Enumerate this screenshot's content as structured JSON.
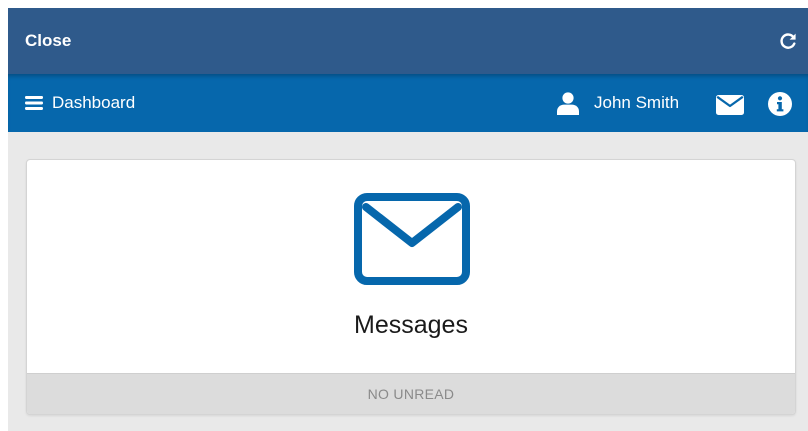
{
  "topbar": {
    "close_label": "Close",
    "refresh_icon": "refresh-icon"
  },
  "navbar": {
    "menu_icon": "hamburger-icon",
    "dashboard_label": "Dashboard",
    "user_icon": "user-icon",
    "user_name": "John Smith",
    "mail_icon": "envelope-icon",
    "info_icon": "info-icon"
  },
  "messages_card": {
    "icon": "envelope-outline-icon",
    "title": "Messages",
    "status": "NO UNREAD"
  },
  "colors": {
    "topbar_bg": "#2f5a8b",
    "navbar_bg": "#0667ac",
    "accent": "#0667ac",
    "page_bg": "#e9e9e9",
    "footer_bg": "#dcdcdc"
  }
}
